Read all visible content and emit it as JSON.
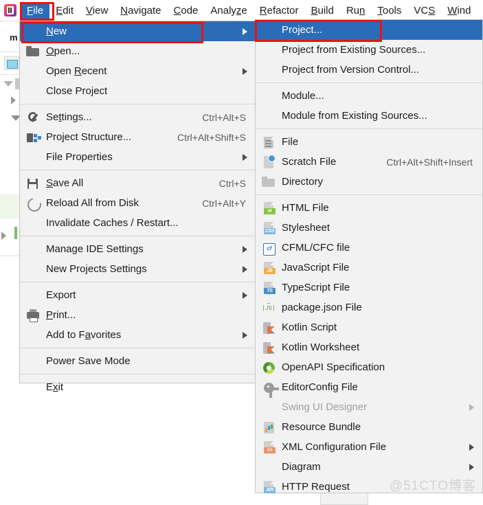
{
  "app": {
    "icon": "intellij-idea-icon"
  },
  "menubar": {
    "items": [
      {
        "label": "File",
        "mnemonic": "F",
        "active": true
      },
      {
        "label": "Edit",
        "mnemonic": "E",
        "active": false
      },
      {
        "label": "View",
        "mnemonic": "V",
        "active": false
      },
      {
        "label": "Navigate",
        "mnemonic": "N",
        "active": false
      },
      {
        "label": "Code",
        "mnemonic": "C",
        "active": false
      },
      {
        "label": "Analyze",
        "mnemonic": "z",
        "active": false
      },
      {
        "label": "Refactor",
        "mnemonic": "R",
        "active": false
      },
      {
        "label": "Build",
        "mnemonic": "B",
        "active": false
      },
      {
        "label": "Run",
        "mnemonic": "n",
        "active": false
      },
      {
        "label": "Tools",
        "mnemonic": "T",
        "active": false
      },
      {
        "label": "VCS",
        "mnemonic": "S",
        "active": false
      },
      {
        "label": "Wind",
        "mnemonic": "W",
        "active": false
      }
    ]
  },
  "background": {
    "tab_label": "m"
  },
  "file_menu": {
    "items": [
      {
        "label": "New",
        "icon": "",
        "accel": "",
        "arrow": true,
        "selected": true
      },
      {
        "label": "Open...",
        "icon": "folder-icon",
        "accel": "",
        "arrow": false,
        "selected": false
      },
      {
        "label": "Open Recent",
        "icon": "",
        "accel": "",
        "arrow": true,
        "selected": false
      },
      {
        "label": "Close Project",
        "icon": "",
        "accel": "",
        "arrow": false,
        "selected": false
      },
      {
        "separator": true
      },
      {
        "label": "Settings...",
        "icon": "wrench-icon",
        "accel": "Ctrl+Alt+S",
        "arrow": false,
        "selected": false
      },
      {
        "label": "Project Structure...",
        "icon": "project-structure-icon",
        "accel": "Ctrl+Alt+Shift+S",
        "arrow": false,
        "selected": false
      },
      {
        "label": "File Properties",
        "icon": "",
        "accel": "",
        "arrow": true,
        "selected": false
      },
      {
        "separator": true
      },
      {
        "label": "Save All",
        "icon": "save-icon",
        "accel": "Ctrl+S",
        "arrow": false,
        "selected": false
      },
      {
        "label": "Reload All from Disk",
        "icon": "reload-icon",
        "accel": "Ctrl+Alt+Y",
        "arrow": false,
        "selected": false
      },
      {
        "label": "Invalidate Caches / Restart...",
        "icon": "",
        "accel": "",
        "arrow": false,
        "selected": false
      },
      {
        "separator": true
      },
      {
        "label": "Manage IDE Settings",
        "icon": "",
        "accel": "",
        "arrow": true,
        "selected": false
      },
      {
        "label": "New Projects Settings",
        "icon": "",
        "accel": "",
        "arrow": true,
        "selected": false
      },
      {
        "separator": true
      },
      {
        "label": "Export",
        "icon": "",
        "accel": "",
        "arrow": true,
        "selected": false
      },
      {
        "label": "Print...",
        "icon": "print-icon",
        "accel": "",
        "arrow": false,
        "selected": false
      },
      {
        "label": "Add to Favorites",
        "icon": "",
        "accel": "",
        "arrow": true,
        "selected": false
      },
      {
        "separator": true
      },
      {
        "label": "Power Save Mode",
        "icon": "",
        "accel": "",
        "arrow": false,
        "selected": false
      },
      {
        "separator": true
      },
      {
        "label": "Exit",
        "icon": "",
        "accel": "",
        "arrow": false,
        "selected": false
      }
    ]
  },
  "new_submenu": {
    "items": [
      {
        "label": "Project...",
        "icon": "",
        "accel": "",
        "arrow": false,
        "selected": true
      },
      {
        "label": "Project from Existing Sources...",
        "icon": "",
        "accel": "",
        "arrow": false,
        "selected": false
      },
      {
        "label": "Project from Version Control...",
        "icon": "",
        "accel": "",
        "arrow": false,
        "selected": false
      },
      {
        "separator": true
      },
      {
        "label": "Module...",
        "icon": "",
        "accel": "",
        "arrow": false,
        "selected": false
      },
      {
        "label": "Module from Existing Sources...",
        "icon": "",
        "accel": "",
        "arrow": false,
        "selected": false
      },
      {
        "separator": true
      },
      {
        "label": "File",
        "icon": "file-icon",
        "accel": "",
        "arrow": false,
        "selected": false
      },
      {
        "label": "Scratch File",
        "icon": "scratch-file-icon",
        "accel": "Ctrl+Alt+Shift+Insert",
        "arrow": false,
        "selected": false
      },
      {
        "label": "Directory",
        "icon": "directory-icon",
        "accel": "",
        "arrow": false,
        "selected": false
      },
      {
        "separator": true
      },
      {
        "label": "HTML File",
        "icon": "html-file-icon",
        "accel": "",
        "arrow": false,
        "selected": false,
        "badge": "H",
        "badge_color": "#8bc34a"
      },
      {
        "label": "Stylesheet",
        "icon": "css-file-icon",
        "accel": "",
        "arrow": false,
        "selected": false,
        "badge": "CSS",
        "badge_color": "#7eb8dd"
      },
      {
        "label": "CFML/CFC file",
        "icon": "cfml-file-icon",
        "accel": "",
        "arrow": false,
        "selected": false
      },
      {
        "label": "JavaScript File",
        "icon": "js-file-icon",
        "accel": "",
        "arrow": false,
        "selected": false,
        "badge": "JS",
        "badge_color": "#f0ad4e"
      },
      {
        "label": "TypeScript File",
        "icon": "ts-file-icon",
        "accel": "",
        "arrow": false,
        "selected": false,
        "badge": "TS",
        "badge_color": "#4a90c4"
      },
      {
        "label": "package.json File",
        "icon": "nodejs-icon",
        "accel": "",
        "arrow": false,
        "selected": false
      },
      {
        "label": "Kotlin Script",
        "icon": "kotlin-icon",
        "accel": "",
        "arrow": false,
        "selected": false
      },
      {
        "label": "Kotlin Worksheet",
        "icon": "kotlin-icon",
        "accel": "",
        "arrow": false,
        "selected": false
      },
      {
        "label": "OpenAPI Specification",
        "icon": "openapi-icon",
        "accel": "",
        "arrow": false,
        "selected": false
      },
      {
        "label": "EditorConfig File",
        "icon": "gear-icon",
        "accel": "",
        "arrow": false,
        "selected": false
      },
      {
        "label": "Swing UI Designer",
        "icon": "",
        "accel": "",
        "arrow": true,
        "selected": false,
        "disabled": true
      },
      {
        "label": "Resource Bundle",
        "icon": "resource-bundle-icon",
        "accel": "",
        "arrow": false,
        "selected": false
      },
      {
        "label": "XML Configuration File",
        "icon": "xml-file-icon",
        "accel": "",
        "arrow": true,
        "selected": false,
        "badge": "<>",
        "badge_color": "#e8956b"
      },
      {
        "label": "Diagram",
        "icon": "",
        "accel": "",
        "arrow": true,
        "selected": false
      },
      {
        "label": "HTTP Request",
        "icon": "api-file-icon",
        "accel": "",
        "arrow": false,
        "selected": false,
        "badge": "API",
        "badge_color": "#7eb8dd"
      }
    ]
  },
  "annotations": {
    "boxes": [
      "file-menubar-highlight",
      "new-item-highlight",
      "project-item-highlight"
    ],
    "color": "#ee1111"
  },
  "watermark": {
    "text": "@51CTO博客"
  }
}
